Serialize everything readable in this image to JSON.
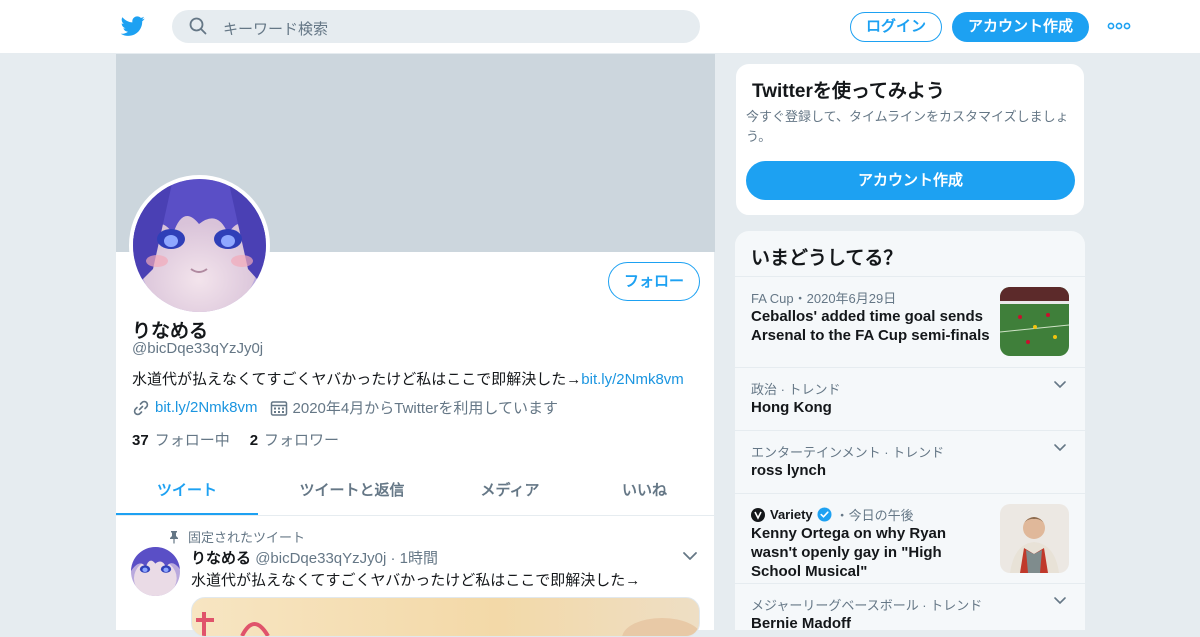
{
  "header": {
    "search_placeholder": "キーワード検索",
    "login_label": "ログイン",
    "signup_label": "アカウント作成"
  },
  "profile": {
    "display_name": "りなめる",
    "handle": "@bicDqe33qYzJy0j",
    "bio_text": "水道代が払えなくてすごくヤバかったけど私はここで即解決した→",
    "bio_link": "bit.ly/2Nmk8vm",
    "website": "bit.ly/2Nmk8vm",
    "joined": "2020年4月からTwitterを利用しています",
    "following_count": "37",
    "following_label": "フォロー中",
    "followers_count": "2",
    "followers_label": "フォロワー",
    "follow_button": "フォロー"
  },
  "tabs": [
    {
      "label": "ツイート",
      "active": true
    },
    {
      "label": "ツイートと返信",
      "active": false
    },
    {
      "label": "メディア",
      "active": false
    },
    {
      "label": "いいね",
      "active": false
    }
  ],
  "pinned_tweet": {
    "pin_label": "固定されたツイート",
    "name": "りなめる",
    "handle": "@bicDqe33qYzJy0j",
    "time": "· 1時間",
    "text": "水道代が払えなくてすごくヤバかったけど私はここで即解決した→"
  },
  "signup_card": {
    "title": "Twitterを使ってみよう",
    "subtitle": "今すぐ登録して、タイムラインをカスタマイズしましょう。",
    "button": "アカウント作成"
  },
  "trends": {
    "title": "いまどうしてる？",
    "items": [
      {
        "meta": "FA Cup・2020年6月29日",
        "headline": "Ceballos' added time goal sends Arsenal to the FA Cup semi-finals"
      },
      {
        "meta": "政治 · トレンド",
        "name": "Hong Kong"
      },
      {
        "meta": "エンターテインメント · トレンド",
        "name": "ross lynch"
      },
      {
        "source": "Variety",
        "meta": "・今日の午後",
        "headline": "Kenny Ortega on why Ryan wasn't openly gay in \"High School Musical\""
      },
      {
        "meta": "メジャーリーグベースボール · トレンド",
        "name": "Bernie Madoff"
      }
    ]
  },
  "colors": {
    "accent": "#1da1f2",
    "link": "#1b95e0",
    "banner": "#ccd6dd",
    "page_bg": "#e6ecf0",
    "muted_text": "#657786"
  }
}
